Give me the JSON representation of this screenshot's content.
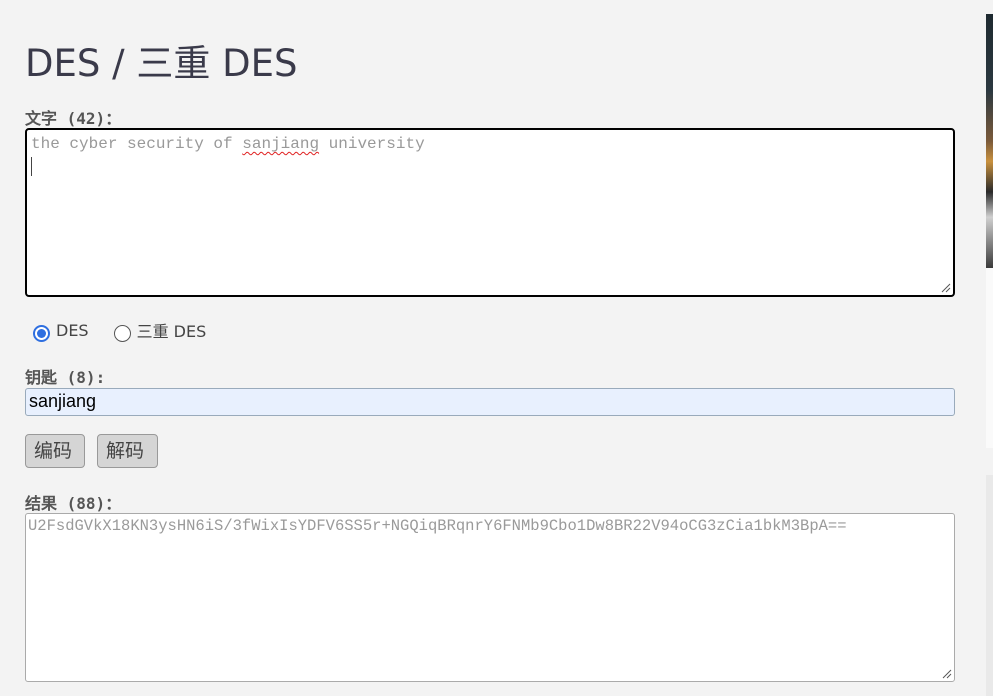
{
  "page": {
    "title": "DES / 三重 DES"
  },
  "text_section": {
    "label": "文字",
    "count": "(42)",
    "colon": "：",
    "value_before": "the cyber security of ",
    "value_misspelled": "sanjiang",
    "value_after": " university"
  },
  "mode": {
    "options": [
      {
        "label": "DES",
        "selected": true
      },
      {
        "label": "三重 DES",
        "selected": false
      }
    ]
  },
  "key_section": {
    "label": "钥匙",
    "count": "(8)",
    "colon": ":",
    "value": "sanjiang"
  },
  "buttons": {
    "encode": "编码",
    "decode": "解码"
  },
  "result_section": {
    "label": "结果",
    "count": "(88)",
    "colon": "：",
    "value": "U2FsdGVkX18KN3ysHN6iS/3fWixIsYDFV6SS5r+NGQiqBRqnrY6FNMb9Cbo1Dw8BR22V94oCG3zCia1bkM3BpA=="
  },
  "colors": {
    "accent": "#2f6fe0",
    "spellcheck": "#e02020",
    "key_bg": "#e8f0fe"
  }
}
